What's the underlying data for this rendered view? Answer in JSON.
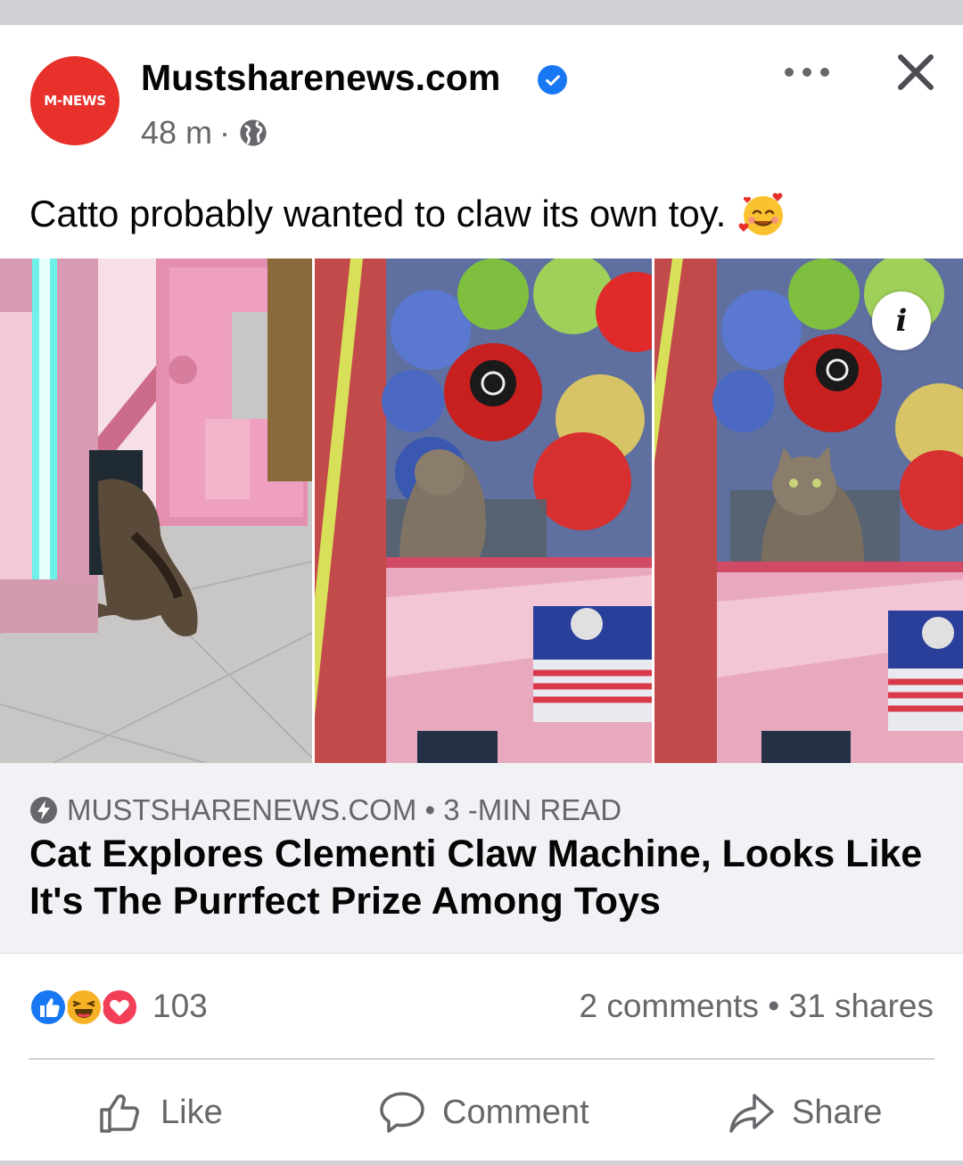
{
  "post": {
    "page_name": "Mustsharenews.com",
    "avatar_text": "M-NEWS",
    "time": "48 m",
    "meta_separator": "·",
    "caption": "Catto probably wanted to claw its own toy.",
    "caption_emoji": "smiling-face-with-hearts-emoji"
  },
  "link_preview": {
    "domain_line": "MUSTSHARENEWS.COM • 3 -MIN READ",
    "title": "Cat Explores Clementi Claw Machine, Looks Like It's The Purrfect Prize Among Toys"
  },
  "stats": {
    "reaction_count": "103",
    "reactions": [
      "like",
      "haha",
      "love"
    ],
    "engagement": "2 comments • 31 shares"
  },
  "actions": {
    "like": "Like",
    "comment": "Comment",
    "share": "Share"
  },
  "icons": {
    "verified": "verified-badge-icon",
    "privacy": "globe-icon",
    "more": "more-options-icon",
    "close": "close-icon",
    "info": "info-icon",
    "link": "bolt-icon"
  },
  "colors": {
    "brand_blue": "#1877f2",
    "avatar_red": "#e8312b",
    "text_secondary": "#65676b",
    "link_bg": "#f0f2f5"
  }
}
